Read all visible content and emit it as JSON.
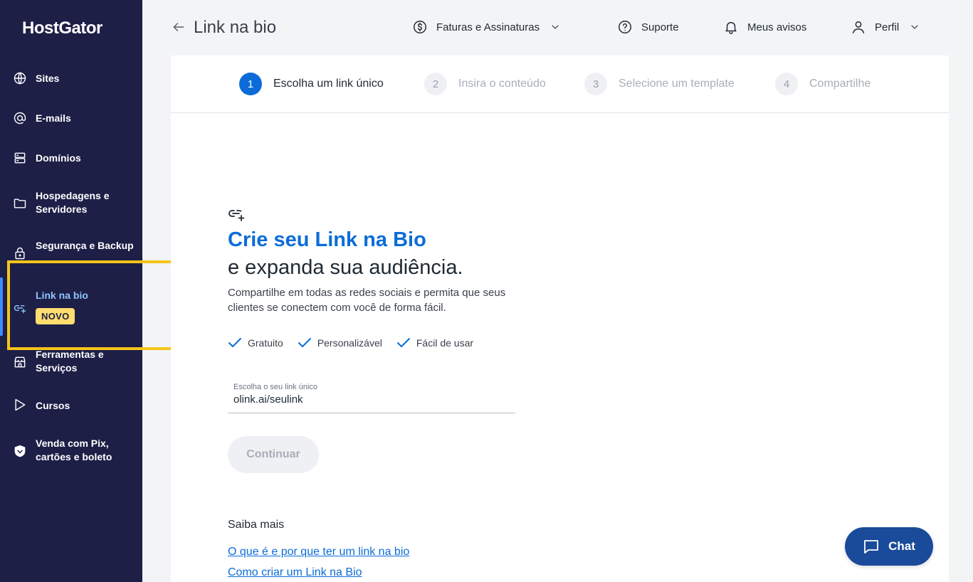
{
  "sidebar": {
    "logo": "HostGator",
    "items": [
      {
        "label": "Sites",
        "icon": "globe-icon"
      },
      {
        "label": "E-mails",
        "icon": "at-icon"
      },
      {
        "label": "Domínios",
        "icon": "server-icon"
      },
      {
        "label": "Hospedagens e Servidores",
        "icon": "folder-icon"
      },
      {
        "label": "Segurança e Backup",
        "icon": "lock-icon"
      },
      {
        "label": "Link na bio",
        "icon": "link-add-icon",
        "active": true
      },
      {
        "label": "Ferramentas e Serviços",
        "icon": "store-icon"
      },
      {
        "label": "Cursos",
        "icon": "play-icon"
      },
      {
        "label": "Venda com Pix, cartões e boleto",
        "icon": "shield-icon"
      }
    ],
    "badge": "NOVO"
  },
  "header": {
    "title": "Link na bio",
    "billing": "Faturas e Assinaturas",
    "support": "Suporte",
    "notices": "Meus avisos",
    "profile": "Perfil"
  },
  "stepper": [
    {
      "num": "1",
      "label": "Escolha um link único",
      "active": true
    },
    {
      "num": "2",
      "label": "Insira o conteúdo"
    },
    {
      "num": "3",
      "label": "Selecione um template"
    },
    {
      "num": "4",
      "label": "Compartilhe"
    }
  ],
  "hero": {
    "title": "Crie seu Link na Bio",
    "subtitle": "e expanda sua audiência.",
    "description": "Compartilhe em todas as redes sociais e permita que seus clientes se conectem com você de forma fácil.",
    "features": [
      "Gratuito",
      "Personalizável",
      "Fácil de usar"
    ]
  },
  "form": {
    "label": "Escolha o seu link único",
    "value": "olink.ai/seulink",
    "button": "Continuar"
  },
  "learn_more": {
    "heading": "Saiba mais",
    "links": [
      "O que é e por que ter um link na bio",
      "Como criar um Link na Bio"
    ]
  },
  "chat": {
    "label": "Chat"
  },
  "colors": {
    "sidebar": "#1e1f47",
    "accent": "#0b6cd8",
    "highlight": "#f5c518",
    "badge": "#ffdd6e"
  }
}
